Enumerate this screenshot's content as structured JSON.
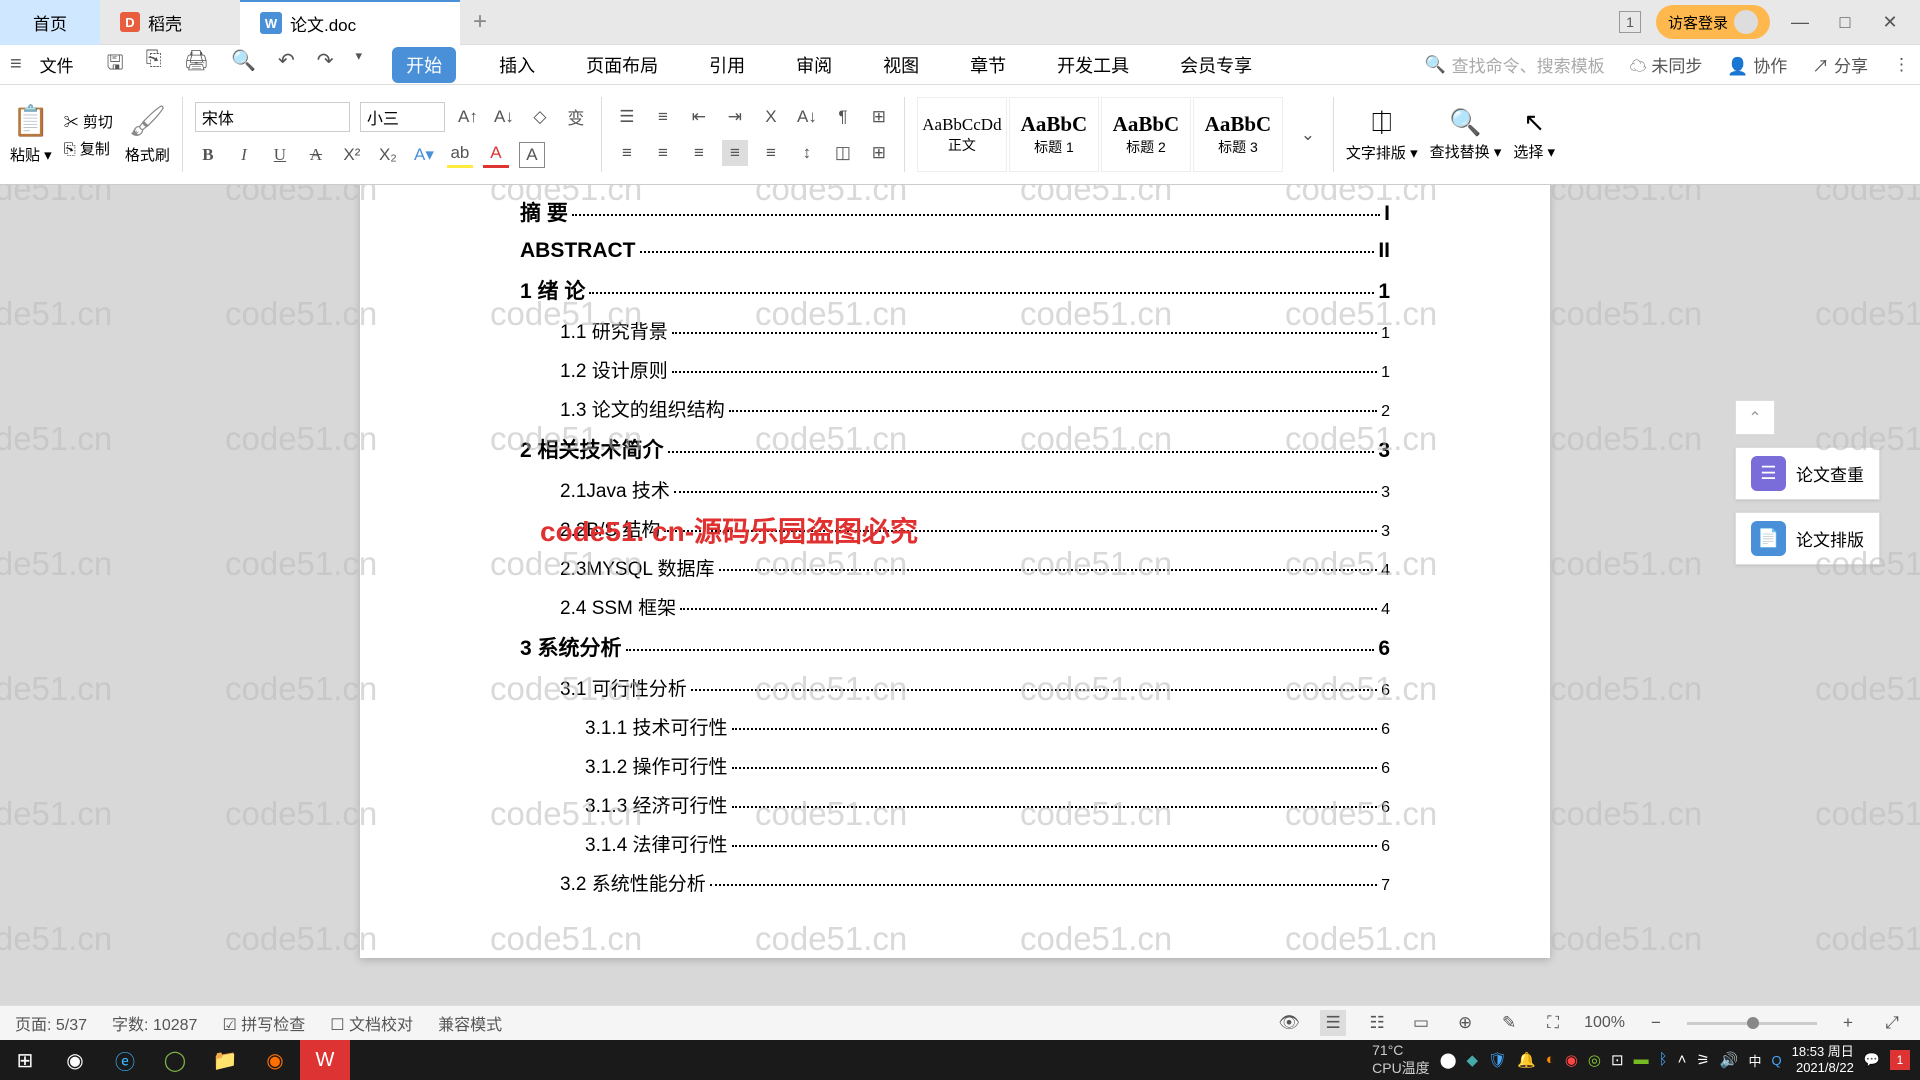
{
  "tabs": {
    "home": "首页",
    "daoke": "稻壳",
    "doc": "论文.doc"
  },
  "titlebar": {
    "window_num": "1",
    "guest": "访客登录"
  },
  "menu": {
    "file": "文件",
    "tabs": [
      "开始",
      "插入",
      "页面布局",
      "引用",
      "审阅",
      "视图",
      "章节",
      "开发工具",
      "会员专享"
    ],
    "search_placeholder": "查找命令、搜索模板",
    "sync": "未同步",
    "coop": "协作",
    "share": "分享"
  },
  "ribbon": {
    "paste": "粘贴",
    "cut": "剪切",
    "copy": "复制",
    "format_painter": "格式刷",
    "font": "宋体",
    "size": "小三",
    "styles": [
      {
        "prev": "AaBbCcDd",
        "label": "正文"
      },
      {
        "prev": "AaBbC",
        "label": "标题 1"
      },
      {
        "prev": "AaBbC",
        "label": "标题 2"
      },
      {
        "prev": "AaBbC",
        "label": "标题 3"
      }
    ],
    "text_layout": "文字排版",
    "find_replace": "查找替换",
    "select": "选择"
  },
  "toc": [
    {
      "lvl": 0,
      "title": "摘  要",
      "page": "I"
    },
    {
      "lvl": 0,
      "title": "ABSTRACT",
      "page": "II"
    },
    {
      "lvl": 0,
      "title": "1 绪  论",
      "page": "1"
    },
    {
      "lvl": 1,
      "title": "1.1 研究背景",
      "page": "1"
    },
    {
      "lvl": 1,
      "title": "1.2 设计原则",
      "page": "1"
    },
    {
      "lvl": 1,
      "title": "1.3 论文的组织结构",
      "page": "2"
    },
    {
      "lvl": 0,
      "title": "2  相关技术简介",
      "page": "3"
    },
    {
      "lvl": 1,
      "title": "2.1Java 技术",
      "page": "3"
    },
    {
      "lvl": 1,
      "title": "2.2B/S 结构",
      "page": "3"
    },
    {
      "lvl": 1,
      "title": "2.3MYSQL 数据库",
      "page": "4"
    },
    {
      "lvl": 1,
      "title": "2.4 SSM 框架",
      "page": "4"
    },
    {
      "lvl": 0,
      "title": "3  系统分析",
      "page": "6"
    },
    {
      "lvl": 1,
      "title": "3.1 可行性分析",
      "page": "6"
    },
    {
      "lvl": 2,
      "title": "3.1.1 技术可行性",
      "page": "6"
    },
    {
      "lvl": 2,
      "title": "3.1.2 操作可行性",
      "page": "6"
    },
    {
      "lvl": 2,
      "title": "3.1.3 经济可行性",
      "page": "6"
    },
    {
      "lvl": 2,
      "title": "3.1.4 法律可行性",
      "page": "6"
    },
    {
      "lvl": 1,
      "title": "3.2 系统性能分析",
      "page": "7"
    }
  ],
  "overlay": "code51. cn-源码乐园盗图必究",
  "watermark": "code51.cn",
  "sidepanel": {
    "check": "论文查重",
    "layout": "论文排版"
  },
  "status": {
    "page": "页面: 5/37",
    "wordcount": "字数: 10287",
    "spell": "拼写检查",
    "proof": "文档校对",
    "compat": "兼容模式",
    "zoom": "100%"
  },
  "taskbar": {
    "temp": "71°C",
    "cpu": "CPU温度",
    "ime": "中",
    "time": "18:53 周日",
    "date": "2021/8/22",
    "badge": "1"
  }
}
